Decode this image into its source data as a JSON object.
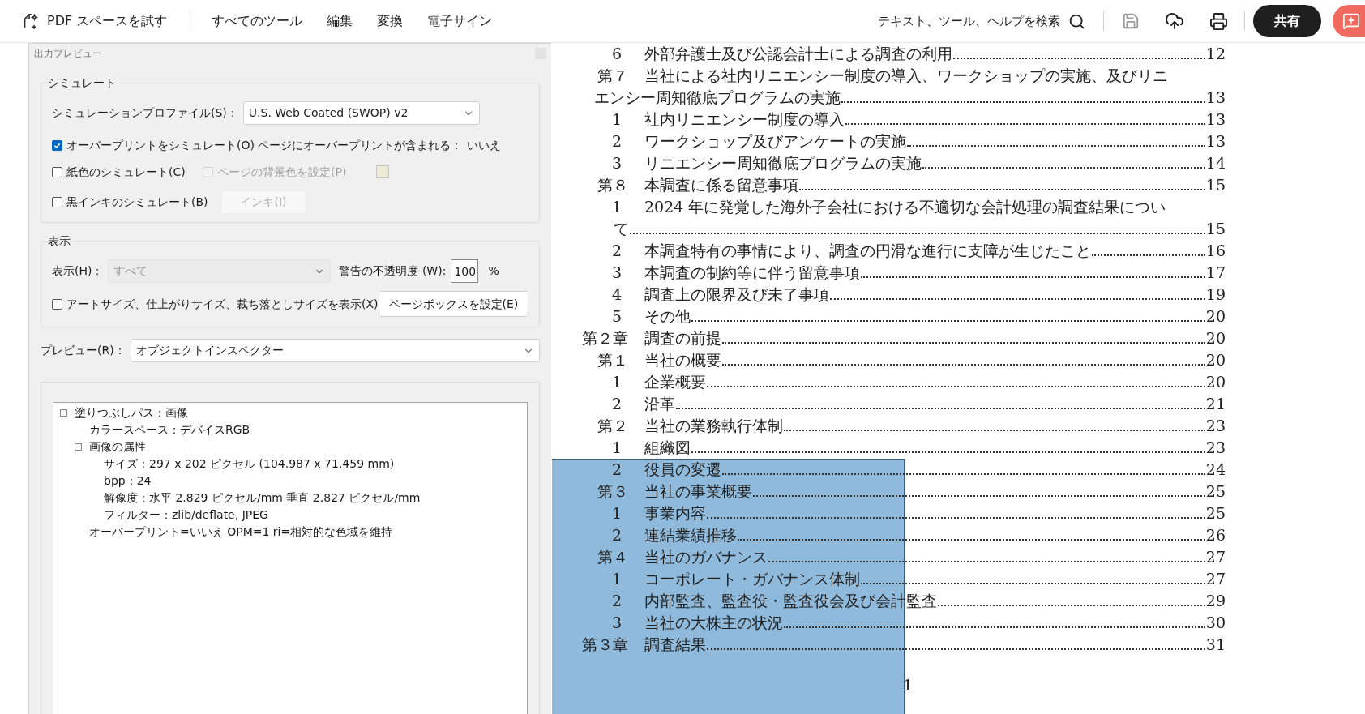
{
  "toolbar": {
    "trial_label": "PDF スペースを試す",
    "menu": [
      "すべてのツール",
      "編集",
      "変換",
      "電子サイン"
    ],
    "search_label": "テキスト、ツール、ヘルプを検索",
    "share_label": "共有"
  },
  "dialog": {
    "title": "出力プレビュー",
    "simulate": {
      "legend": "シミュレート",
      "profile_label": "シミュレーションプロファイル(S)：",
      "profile_value": "U.S. Web Coated (SWOP) v2",
      "overprint": {
        "label": "オーバープリントをシミュレート(O)",
        "checked": true
      },
      "overprint_info_label": "ページにオーバープリントが含まれる：",
      "overprint_info_value": "いいえ",
      "paper": {
        "label": "紙色のシミュレート(C)",
        "checked": false
      },
      "background": {
        "label": "ページの背景色を設定(P)",
        "checked": false,
        "disabled": true
      },
      "black_ink": {
        "label": "黒インキのシミュレート(B)",
        "checked": false
      },
      "ink_button": {
        "label": "インキ(I)",
        "disabled": true
      }
    },
    "display": {
      "legend": "表示",
      "show_label": "表示(H)：",
      "show_value": "すべて",
      "show_disabled": true,
      "opacity_label": "警告の不透明度 (W):",
      "opacity_value": "100",
      "percent": "%",
      "boxes": {
        "label": "アートサイズ、仕上がりサイズ、裁ち落としサイズを表示(X)",
        "checked": false
      },
      "page_box_button": "ページボックスを設定(E)"
    },
    "preview_label": "プレビュー(R)：",
    "preview_value": "オブジェクトインスペクター",
    "tree": [
      {
        "label": "塗りつぶしパス：画像",
        "expanded": true,
        "children": [
          {
            "label": "カラースペース：デバイスRGB"
          },
          {
            "label": "画像の属性",
            "expanded": true,
            "children": [
              {
                "label": "サイズ：297 x 202 ピクセル (104.987 x 71.459 mm)"
              },
              {
                "label": "bpp：24"
              },
              {
                "label": "解像度：水平 2.829 ピクセル/mm 垂直 2.827 ピクセル/mm"
              },
              {
                "label": "フィルター：zlib/deflate, JPEG"
              }
            ]
          },
          {
            "label": "オーバープリント=いいえ OPM=1 ri=相対的な色域を維持"
          }
        ]
      }
    ]
  },
  "document": {
    "toc": [
      {
        "kind": "item",
        "number": "6",
        "title": "外部弁護士及び公認会計士による調査の利用",
        "page": "12"
      },
      {
        "kind": "section",
        "number": "第７",
        "title": "当社による社内リニエンシー制度の導入、ワークショップの実施、及びリニ",
        "continuation": "エンシー周知徹底プログラムの実施",
        "page": "13"
      },
      {
        "kind": "item",
        "number": "1",
        "title": "社内リニエンシー制度の導入",
        "page": "13"
      },
      {
        "kind": "item",
        "number": "2",
        "title": "ワークショップ及びアンケートの実施",
        "page": "13"
      },
      {
        "kind": "item",
        "number": "3",
        "title": "リニエンシー周知徹底プログラムの実施",
        "page": "14"
      },
      {
        "kind": "section",
        "number": "第８",
        "title": "本調査に係る留意事項",
        "page": "15"
      },
      {
        "kind": "item",
        "number": "1",
        "title": "2024 年に発覚した海外子会社における不適切な会計処理の調査結果につい",
        "continuation": "て",
        "page": "15"
      },
      {
        "kind": "item",
        "number": "2",
        "title": "本調査特有の事情により、調査の円滑な進行に支障が生じたこと",
        "page": "16"
      },
      {
        "kind": "item",
        "number": "3",
        "title": "本調査の制約等に伴う留意事項",
        "page": "17"
      },
      {
        "kind": "item",
        "number": "4",
        "title": "調査上の限界及び未了事項",
        "page": "19"
      },
      {
        "kind": "item",
        "number": "5",
        "title": "その他",
        "page": "20"
      },
      {
        "kind": "chapter",
        "number": "第２章",
        "title": "調査の前提",
        "page": "20"
      },
      {
        "kind": "section",
        "number": "第１",
        "title": "当社の概要",
        "page": "20"
      },
      {
        "kind": "item",
        "number": "1",
        "title": "企業概要",
        "page": "20"
      },
      {
        "kind": "item",
        "number": "2",
        "title": "沿革",
        "page": "21"
      },
      {
        "kind": "section",
        "number": "第２",
        "title": "当社の業務執行体制",
        "page": "23"
      },
      {
        "kind": "item",
        "number": "1",
        "title": "組織図",
        "page": "23"
      },
      {
        "kind": "item",
        "number": "2",
        "title": "役員の変遷",
        "page": "24"
      },
      {
        "kind": "section",
        "number": "第３",
        "title": "当社の事業概要",
        "page": "25"
      },
      {
        "kind": "item",
        "number": "1",
        "title": "事業内容",
        "page": "25"
      },
      {
        "kind": "item",
        "number": "2",
        "title": "連結業績推移",
        "page": "26"
      },
      {
        "kind": "section",
        "number": "第４",
        "title": "当社のガバナンス",
        "page": "27"
      },
      {
        "kind": "item",
        "number": "1",
        "title": "コーポレート・ガバナンス体制",
        "page": "27"
      },
      {
        "kind": "item",
        "number": "2",
        "title": "内部監査、監査役・監査役会及び会計監査",
        "page": "29"
      },
      {
        "kind": "item",
        "number": "3",
        "title": "当社の大株主の状況",
        "page": "30"
      },
      {
        "kind": "chapter",
        "number": "第３章",
        "title": "調査結果",
        "page": "31"
      }
    ],
    "page_number": "1"
  }
}
